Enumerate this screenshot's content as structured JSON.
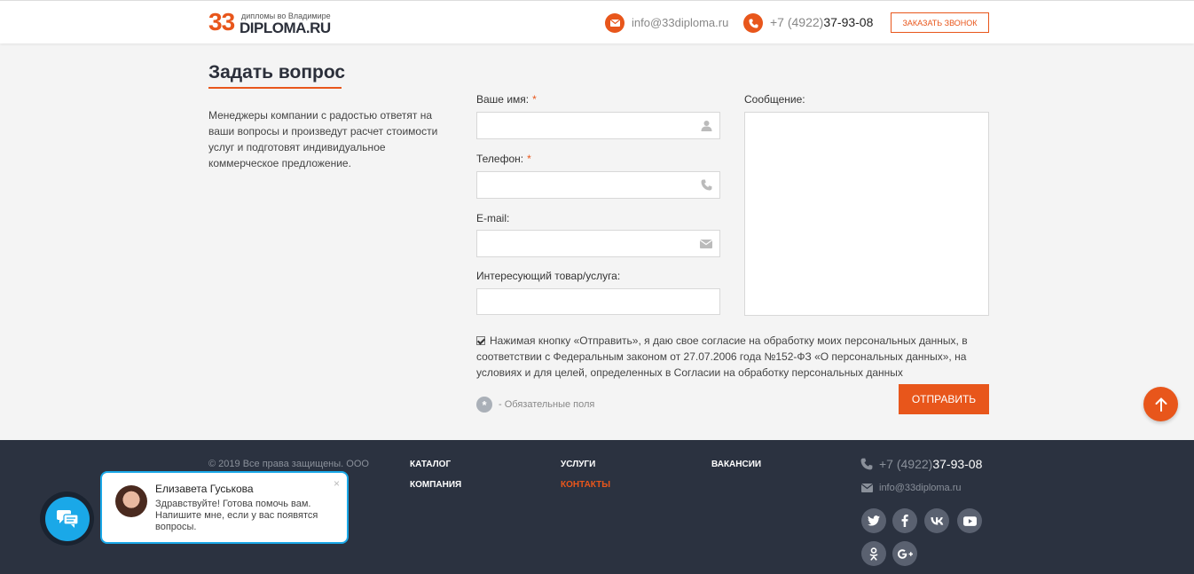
{
  "header": {
    "logo_number": "33",
    "logo_subtitle": "дипломы во Владимире",
    "logo_name": "DIPLOMA.RU",
    "email": "info@33diploma.ru",
    "phone_prefix": "+7 (4922)",
    "phone_number": "37-93-08",
    "callback_label": "Заказать звонок"
  },
  "main": {
    "title": "Задать вопрос",
    "description": "Менеджеры компании с радостью ответят на ваши вопросы и произведут расчет стоимости услуг и подготовят индивидуальное коммерческое предложение."
  },
  "form": {
    "name_label": "Ваше имя:",
    "phone_label": "Телефон:",
    "email_label": "E-mail:",
    "product_label": "Интересующий товар/услуга:",
    "message_label": "Сообщение:",
    "required_mark": "*",
    "name_value": "",
    "phone_value": "",
    "email_value": "",
    "product_value": "",
    "message_value": "",
    "consent_checked": true,
    "consent_text": "Нажимая кнопку «Отправить», я даю свое согласие на обработку моих персональных данных, в соответствии с Федеральным законом от 27.07.2006 года №152-ФЗ «О персональных данных», на условиях и для целей, определенных в Согласии на обработку персональных данных",
    "required_note": "- Обязательные поля",
    "submit_label": "Отправить"
  },
  "footer": {
    "copyright": "© 2019 Все права защищены. ООО",
    "nav": {
      "catalog": "Каталог",
      "company": "Компания",
      "services": "Услуги",
      "contacts": "Контакты",
      "vacancies": "Вакансии"
    },
    "phone_prefix": "+7 (4922)",
    "phone_number": "37-93-08",
    "email": "info@33diploma.ru",
    "social": [
      "twitter-icon",
      "facebook-icon",
      "vk-icon",
      "youtube-icon",
      "odnoklassniki-icon",
      "google-plus-icon"
    ]
  },
  "chat": {
    "agent_name": "Елизавета Гуськова",
    "message": "Здравствуйте! Готова помочь вам. Напишите мне, если у вас появятся вопросы.",
    "close": "×"
  },
  "colors": {
    "accent": "#e8561b",
    "footer_bg": "#2b3240",
    "chat_blue": "#1aa8e8"
  }
}
